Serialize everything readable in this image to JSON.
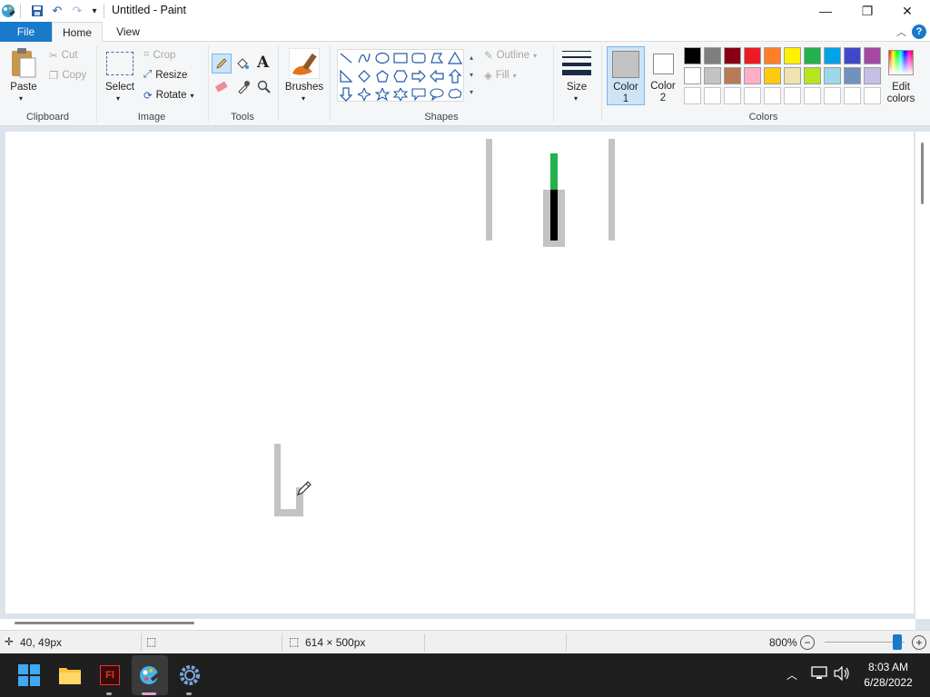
{
  "window": {
    "title": "Untitled - Paint",
    "minimize": "—",
    "maximize": "❐",
    "close": "✕"
  },
  "tabs": {
    "file": "File",
    "home": "Home",
    "view": "View",
    "help": "?"
  },
  "clipboard": {
    "paste": "Paste",
    "cut": "Cut",
    "copy": "Copy",
    "group": "Clipboard"
  },
  "image": {
    "select": "Select",
    "crop": "Crop",
    "resize": "Resize",
    "rotate": "Rotate",
    "group": "Image"
  },
  "tools": {
    "group": "Tools",
    "text_glyph": "A"
  },
  "brushes": {
    "label": "Brushes"
  },
  "shapes": {
    "outline": "Outline",
    "fill": "Fill",
    "group": "Shapes"
  },
  "size": {
    "label": "Size"
  },
  "colors": {
    "color1_line1": "Color",
    "color1_line2": "1",
    "color2_line1": "Color",
    "color2_line2": "2",
    "edit_line1": "Edit",
    "edit_line2": "colors",
    "group": "Colors",
    "color1_value": "#c3c3c3",
    "color2_value": "#ffffff",
    "palette_row1": [
      "#000000",
      "#7f7f7f",
      "#880015",
      "#ed1c24",
      "#ff7f27",
      "#fff200",
      "#22b14c",
      "#00a2e8",
      "#3f48cc",
      "#a349a4"
    ],
    "palette_row2": [
      "#ffffff",
      "#c3c3c3",
      "#b97a57",
      "#ffaec9",
      "#ffc90e",
      "#efe4b0",
      "#b5e61d",
      "#99d9ea",
      "#7092be",
      "#c8bfe7"
    ]
  },
  "statusbar": {
    "cursor_pos": "40, 49px",
    "canvas_size": "614 × 500px",
    "zoom": "800%"
  },
  "taskbar": {
    "time": "8:03 AM",
    "date": "6/28/2022",
    "app_adobe_label": "Fl"
  }
}
